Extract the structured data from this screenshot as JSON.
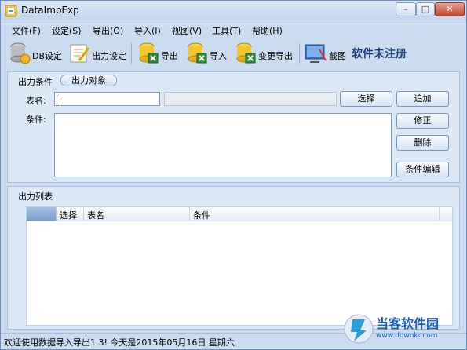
{
  "window": {
    "title": "DataImpExp"
  },
  "menu": [
    {
      "label": "文件(F)"
    },
    {
      "label": "设定(S)"
    },
    {
      "label": "导出(O)"
    },
    {
      "label": "导入(I)"
    },
    {
      "label": "视图(V)"
    },
    {
      "label": "工具(T)"
    },
    {
      "label": "帮助(H)"
    }
  ],
  "toolbar": {
    "db_settings": "DB设定",
    "output_settings": "出力设定",
    "export": "导出",
    "import": "导入",
    "change_export": "变更导出",
    "screenshot": "截图",
    "unregistered": "软件未注册"
  },
  "output_conditions": {
    "section_label": "出力条件",
    "tab_label": "出力对象",
    "table_name_label": "表名:",
    "table_name_value": "",
    "condition_label": "条件:",
    "condition_value": "",
    "select_button": "选择",
    "add_button": "追加",
    "modify_button": "修正",
    "delete_button": "删除",
    "edit_condition_button": "条件编辑"
  },
  "output_list": {
    "section_label": "出力列表",
    "columns": [
      "选择",
      "表名",
      "条件"
    ],
    "rows": []
  },
  "status": {
    "text": "欢迎使用数据导入导出1.3! 今天是2015年05月16日   星期六"
  },
  "watermark": {
    "text": "当客软件园",
    "sub": "www.downkr.com"
  }
}
